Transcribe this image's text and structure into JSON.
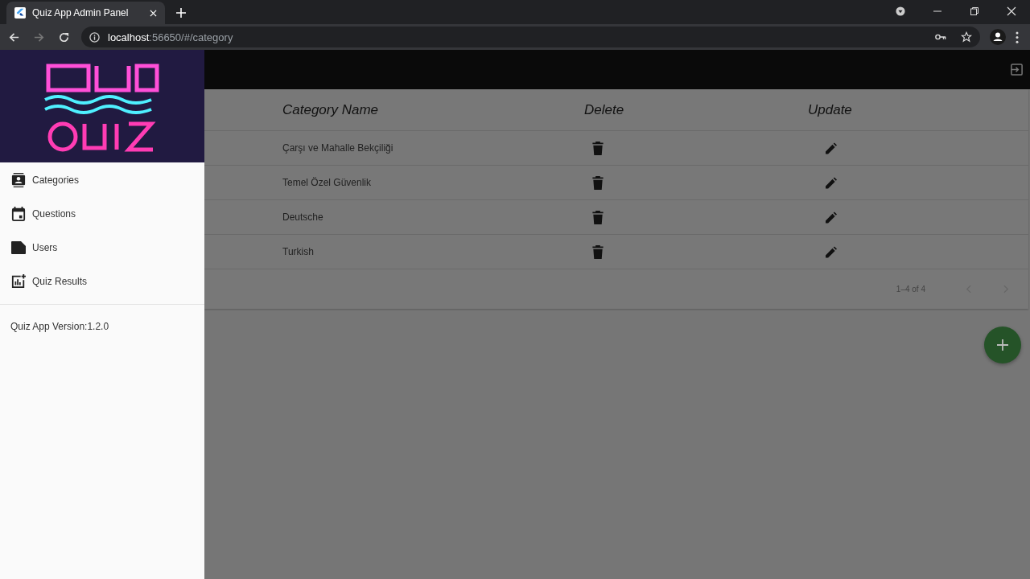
{
  "browser": {
    "tabs": [
      {
        "title": "Quiz App Admin Panel",
        "selected": true
      }
    ],
    "address": {
      "host": "localhost",
      "rest": ":56650/#/category"
    }
  },
  "drawer": {
    "items": [
      {
        "label": "Categories"
      },
      {
        "label": "Questions"
      },
      {
        "label": "Users"
      },
      {
        "label": "Quiz Results"
      }
    ],
    "version": "Quiz App Version:1.2.0"
  },
  "table": {
    "columns": [
      "Category Name",
      "Delete",
      "Update"
    ],
    "rows": [
      {
        "name": "Çarşı ve Mahalle Bekçiliği"
      },
      {
        "name": "Temel Özel Güvenlik"
      },
      {
        "name": "Deutsche"
      },
      {
        "name": "Turkish"
      }
    ],
    "pagination": "1–4 of 4"
  }
}
